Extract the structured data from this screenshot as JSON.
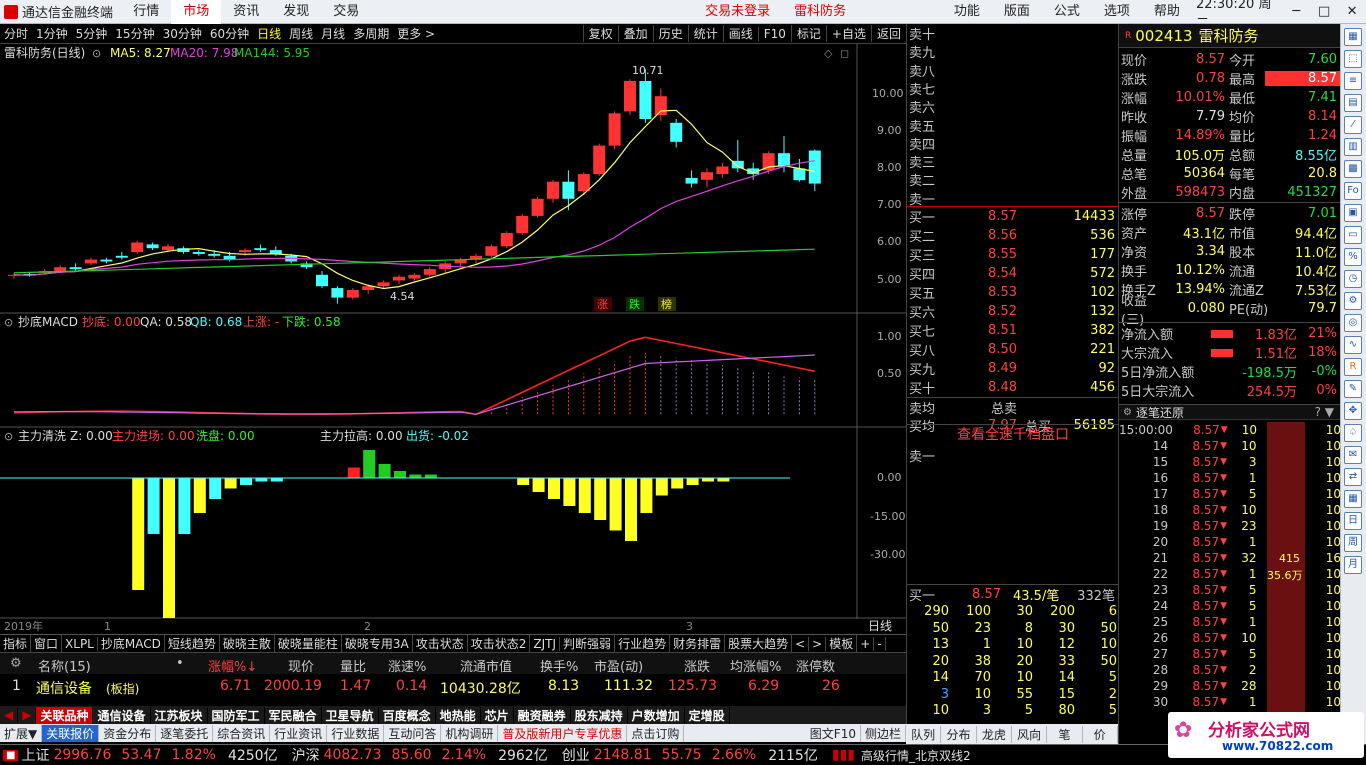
{
  "window": {
    "app_name": "通达信金融终端",
    "menus": [
      "行情",
      "市场",
      "资讯",
      "发现",
      "交易"
    ],
    "active_menu": "市场",
    "trade_status": "交易未登录",
    "stock_tag": "雷科防务",
    "right_menus": [
      "功能",
      "版面",
      "公式",
      "选项",
      "帮助"
    ],
    "time": "22:30:20",
    "weekday": "周二"
  },
  "timeframes": [
    "分时",
    "1分钟",
    "5分钟",
    "15分钟",
    "30分钟",
    "60分钟",
    "日线",
    "周线",
    "月线",
    "多周期",
    "更多 >"
  ],
  "active_timeframe": "日线",
  "chart_tools": [
    "复权",
    "叠加",
    "历史",
    "统计",
    "画线",
    "F10",
    "标记",
    "+自选",
    "返回"
  ],
  "main_chart": {
    "title": "雷科防务(日线)",
    "ma5": "MA5: 8.27",
    "ma20": "MA20: 7.98",
    "ma144": "MA144: 5.95",
    "high_label": "10.71",
    "low_label": "4.54",
    "badges": [
      "涨",
      "跌",
      "榜"
    ],
    "ticks": [
      "10.00",
      "9.00",
      "8.00",
      "7.00",
      "6.00",
      "5.00"
    ]
  },
  "macd": {
    "name": "抄底MACD",
    "di": "抄底: 0.00",
    "qa": "QA: 0.58",
    "qb": "QB: 0.68",
    "up": "上涨: -",
    "down": "下跌: 0.58",
    "ticks": [
      "1.00",
      "0.50"
    ]
  },
  "flow": {
    "name": "主力清洗",
    "z": "Z: 0.00",
    "in": "主力进场: 0.00",
    "wash": "洗盘: 0.00",
    "pull": "主力拉高: 0.00",
    "out": "出货: -0.02",
    "ticks": [
      "0.00",
      "-15.00",
      "-30.00"
    ]
  },
  "xaxis": {
    "year": "2019年",
    "m1": "1",
    "m2": "2",
    "m3": "3",
    "period": "日线"
  },
  "chart_data": {
    "type": "candlestick",
    "candles": [
      [
        5.3,
        5.35,
        5.2,
        5.3
      ],
      [
        5.32,
        5.38,
        5.25,
        5.28
      ],
      [
        5.35,
        5.45,
        5.3,
        5.4
      ],
      [
        5.4,
        5.55,
        5.35,
        5.5
      ],
      [
        5.5,
        5.6,
        5.4,
        5.45
      ],
      [
        5.6,
        5.75,
        5.55,
        5.7
      ],
      [
        5.7,
        5.75,
        5.6,
        5.65
      ],
      [
        5.8,
        5.9,
        5.7,
        5.75
      ],
      [
        5.9,
        6.2,
        5.85,
        6.15
      ],
      [
        6.1,
        6.15,
        5.95,
        6.0
      ],
      [
        5.95,
        6.1,
        5.9,
        6.05
      ],
      [
        6.0,
        6.05,
        5.85,
        5.9
      ],
      [
        5.9,
        5.95,
        5.8,
        5.85
      ],
      [
        5.85,
        5.95,
        5.75,
        5.8
      ],
      [
        5.8,
        5.9,
        5.65,
        5.7
      ],
      [
        5.9,
        6.0,
        5.8,
        5.95
      ],
      [
        6.0,
        6.1,
        5.9,
        5.95
      ],
      [
        5.95,
        6.05,
        5.8,
        5.85
      ],
      [
        5.8,
        5.85,
        5.6,
        5.65
      ],
      [
        5.6,
        5.65,
        5.45,
        5.5
      ],
      [
        5.3,
        5.4,
        4.95,
        5.0
      ],
      [
        4.95,
        5.0,
        4.54,
        4.7
      ],
      [
        4.7,
        4.95,
        4.65,
        4.9
      ],
      [
        4.9,
        5.05,
        4.8,
        5.0
      ],
      [
        5.0,
        5.15,
        4.95,
        5.1
      ],
      [
        5.15,
        5.3,
        5.05,
        5.25
      ],
      [
        5.2,
        5.35,
        5.15,
        5.3
      ],
      [
        5.3,
        5.5,
        5.25,
        5.45
      ],
      [
        5.45,
        5.65,
        5.35,
        5.6
      ],
      [
        5.6,
        5.75,
        5.5,
        5.7
      ],
      [
        5.7,
        5.85,
        5.6,
        5.8
      ],
      [
        5.8,
        6.1,
        5.75,
        6.05
      ],
      [
        6.05,
        6.45,
        6.0,
        6.4
      ],
      [
        6.4,
        6.9,
        6.35,
        6.85
      ],
      [
        6.85,
        7.35,
        6.8,
        7.3
      ],
      [
        7.3,
        7.8,
        7.2,
        7.75
      ],
      [
        7.75,
        8.05,
        7.0,
        7.3
      ],
      [
        7.5,
        8.0,
        7.4,
        7.95
      ],
      [
        7.95,
        8.75,
        7.9,
        8.7
      ],
      [
        8.7,
        9.6,
        8.6,
        9.55
      ],
      [
        9.6,
        10.45,
        9.5,
        10.4
      ],
      [
        10.4,
        10.71,
        9.3,
        9.4
      ],
      [
        9.5,
        10.2,
        9.35,
        10.0
      ],
      [
        9.3,
        9.4,
        8.65,
        8.8
      ],
      [
        7.85,
        8.05,
        7.6,
        7.7
      ],
      [
        7.8,
        8.1,
        7.6,
        8.0
      ],
      [
        7.95,
        8.25,
        7.85,
        8.15
      ],
      [
        8.3,
        8.85,
        8.0,
        8.1
      ],
      [
        8.1,
        8.25,
        7.8,
        7.95
      ],
      [
        8.05,
        8.55,
        7.95,
        8.5
      ],
      [
        8.5,
        8.95,
        8.0,
        8.15
      ],
      [
        8.1,
        8.35,
        7.75,
        7.79
      ],
      [
        8.57,
        8.6,
        7.5,
        7.7
      ]
    ],
    "ylim": [
      4.4,
      10.9
    ]
  },
  "orderbook": {
    "sells": [
      "卖十",
      "卖九",
      "卖八",
      "卖七",
      "卖六",
      "卖五",
      "卖四",
      "卖三",
      "卖二",
      "卖一"
    ],
    "buys": [
      [
        "买一",
        "8.57",
        "14433"
      ],
      [
        "买二",
        "8.56",
        "536"
      ],
      [
        "买三",
        "8.55",
        "177"
      ],
      [
        "买四",
        "8.54",
        "572"
      ],
      [
        "买五",
        "8.53",
        "102"
      ],
      [
        "买六",
        "8.52",
        "132"
      ],
      [
        "买七",
        "8.51",
        "382"
      ],
      [
        "买八",
        "8.50",
        "221"
      ],
      [
        "买九",
        "8.49",
        "92"
      ],
      [
        "买十",
        "8.48",
        "456"
      ]
    ],
    "avg_sell_label": "卖均",
    "total_sell_label": "总卖",
    "avg_buy_label": "买均",
    "avg_buy": "7.97",
    "total_buy_label": "总买",
    "total_buy": "56185",
    "full_depth": "查看全速千档盘口",
    "queue_sell": "卖一",
    "queue_buy_label": "买一",
    "queue_buy_price": "8.57",
    "queue_buy_avg": "43.5/笔",
    "queue_buy_count": "332笔",
    "queue": [
      [
        "290",
        "100",
        "30",
        "200",
        "6"
      ],
      [
        "50",
        "23",
        "8",
        "30",
        "50"
      ],
      [
        "13",
        "1",
        "10",
        "12",
        "10"
      ],
      [
        "20",
        "38",
        "20",
        "33",
        "50"
      ],
      [
        "14",
        "70",
        "10",
        "14",
        "5"
      ],
      [
        "3",
        "10",
        "55",
        "15",
        "2"
      ],
      [
        "10",
        "3",
        "5",
        "80",
        "5"
      ]
    ]
  },
  "quote": {
    "code": "002413",
    "name": "雷科防务",
    "rows": [
      [
        "现价",
        "8.57",
        "今开",
        "7.60"
      ],
      [
        "涨跌",
        "0.78",
        "最高",
        "8.57"
      ],
      [
        "涨幅",
        "10.01%",
        "最低",
        "7.41"
      ],
      [
        "昨收",
        "7.79",
        "均价",
        "8.14"
      ],
      [
        "振幅",
        "14.89%",
        "量比",
        "1.24"
      ],
      [
        "总量",
        "105.0万",
        "总额",
        "8.55亿"
      ],
      [
        "总笔",
        "50364",
        "每笔",
        "20.8"
      ],
      [
        "外盘",
        "598473",
        "内盘",
        "451327"
      ],
      [
        "涨停",
        "8.57",
        "跌停",
        "7.01"
      ],
      [
        "资产",
        "43.1亿",
        "市值",
        "94.4亿"
      ],
      [
        "净资",
        "3.34",
        "股本",
        "11.0亿"
      ],
      [
        "换手",
        "10.12%",
        "流通",
        "10.4亿"
      ],
      [
        "换手Z",
        "13.94%",
        "流通Z",
        "7.53亿"
      ],
      [
        "收益(三)",
        "0.080",
        "PE(动)",
        "79.7"
      ]
    ],
    "flows": [
      [
        "净流入额",
        "1.83亿",
        "21%"
      ],
      [
        "大宗流入",
        "1.51亿",
        "18%"
      ],
      [
        "5日净流入额",
        "-198.5万",
        "-0%"
      ],
      [
        "5日大宗流入",
        "254.5万",
        "0%"
      ]
    ]
  },
  "ticks_panel": {
    "title": "逐笔还原",
    "bar_top": "415",
    "bar_bottom": "35.6万",
    "rows": [
      [
        "15:00:00",
        "8.57",
        "10",
        "10"
      ],
      [
        "14",
        "8.57",
        "10",
        "10"
      ],
      [
        "15",
        "8.57",
        "3",
        "10"
      ],
      [
        "16",
        "8.57",
        "1",
        "10"
      ],
      [
        "17",
        "8.57",
        "5",
        "10"
      ],
      [
        "18",
        "8.57",
        "10",
        "10"
      ],
      [
        "19",
        "8.57",
        "23",
        "10"
      ],
      [
        "20",
        "8.57",
        "1",
        "10"
      ],
      [
        "21",
        "8.57",
        "32",
        "16"
      ],
      [
        "22",
        "8.57",
        "1",
        "10"
      ],
      [
        "23",
        "8.57",
        "5",
        "10"
      ],
      [
        "24",
        "8.57",
        "5",
        "10"
      ],
      [
        "25",
        "8.57",
        "1",
        "10"
      ],
      [
        "26",
        "8.57",
        "10",
        "10"
      ],
      [
        "27",
        "8.57",
        "5",
        "10"
      ],
      [
        "28",
        "8.57",
        "2",
        "10"
      ],
      [
        "29",
        "8.57",
        "28",
        "10"
      ],
      [
        "30",
        "8.57",
        "1",
        "10"
      ]
    ]
  },
  "ind_tabs": [
    "指标",
    "窗口",
    "XLPL",
    "抄底MACD",
    "短线趋势",
    "破晓主散",
    "破晓量能柱",
    "破晓专用3A",
    "攻击状态",
    "攻击状态2",
    "ZJTJ",
    "判断强弱",
    "行业趋势",
    "财务排雷",
    "股票大趋势",
    "<",
    ">",
    "模板",
    "+",
    "-"
  ],
  "board": {
    "headers": [
      "名称(15)",
      "•",
      "涨幅%↓",
      "现价",
      "量比",
      "涨速%",
      "流通市值",
      "换手%",
      "市盈(动)",
      "涨跌",
      "均涨幅%",
      "涨停数"
    ],
    "row": [
      "1",
      "通信设备",
      "(板指)",
      "6.71",
      "2000.19",
      "1.47",
      "0.14",
      "10430.28亿",
      "8.13",
      "111.32",
      "125.73",
      "6.29",
      "26"
    ]
  },
  "blocks": [
    "关联品种",
    "通信设备",
    "江苏板块",
    "国防军工",
    "军民融合",
    "卫星导航",
    "百度概念",
    "地热能",
    "芯片",
    "融资融券",
    "股东减持",
    "户数增加",
    "定增股"
  ],
  "explore": [
    "扩展▼",
    "关联报价",
    "资金分布",
    "逐笔委托",
    "综合资讯",
    "行业资讯",
    "行业数据",
    "互动问答",
    "机构调研",
    "普及版新用户专享优惠",
    "点击订购",
    "图文F10",
    "侧边栏"
  ],
  "side_tabs": [
    "队列",
    "分布",
    "龙虎",
    "风向",
    "笔",
    "价"
  ],
  "status": {
    "sh_label": "上证",
    "sh": "2996.76",
    "sh_chg": "53.47",
    "sh_pct": "1.82%",
    "sh_amt": "4250亿",
    "sz_label": "沪深",
    "sz": "4082.73",
    "sz_chg": "85.60",
    "sz_pct": "2.14%",
    "sz_amt": "2962亿",
    "cy_label": "创业",
    "cy": "2148.81",
    "cy_chg": "55.75",
    "cy_pct": "2.66%",
    "cy_amt": "2115亿",
    "feed": "高级行情_北京双线2",
    "brand": "分析家公式网",
    "brand_url": "www.70822.com"
  },
  "colors": {
    "up": "#ff3333",
    "down": "#44ffff",
    "ma5": "#ffff66",
    "ma20": "#e040e0",
    "ma144": "#22cc22"
  }
}
